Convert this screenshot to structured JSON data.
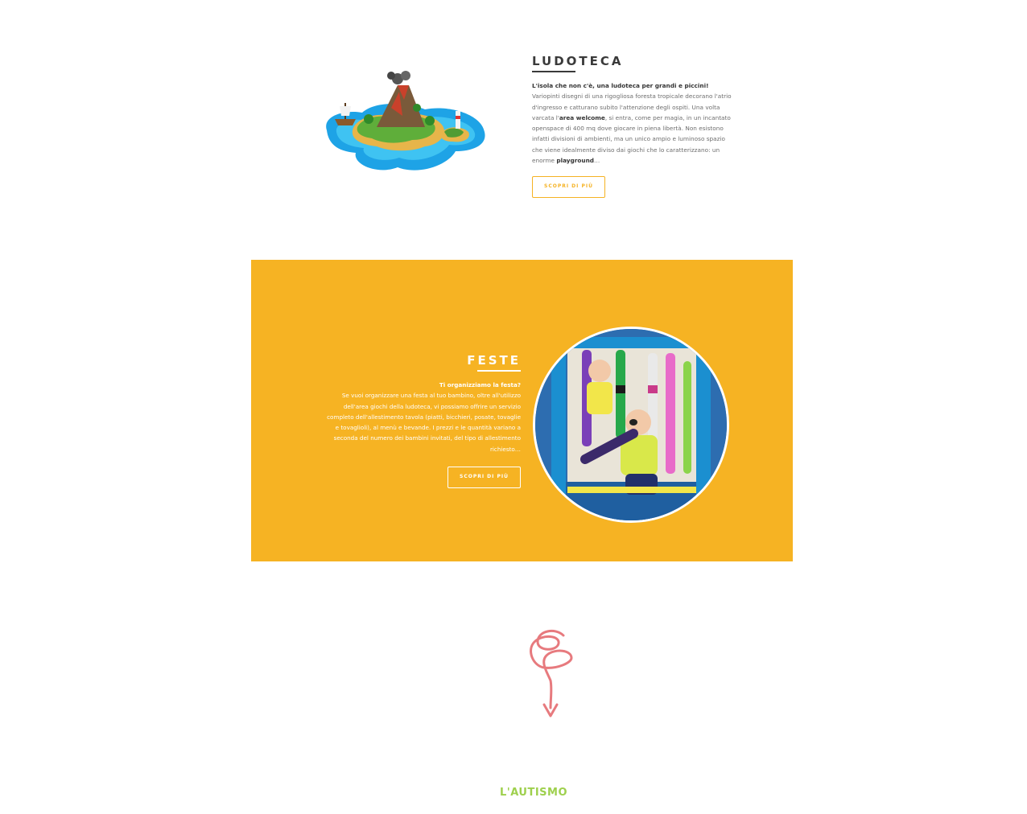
{
  "ludoteca": {
    "title": "LUDOTECA",
    "intro": "L'isola che non c'è, una ludoteca per grandi e piccini!",
    "body_1": "Variopinti disegni di una rigogliosa foresta tropicale decorano l'atrio d'ingresso e catturano subito l'attenzione degli ospiti. Una volta varcata l'",
    "body_bold_1": "area welcome",
    "body_2": ", si entra, come per magia, in un incantato openspace di 400 mq dove giocare in piena libertà. Non esistono infatti divisioni di ambienti, ma un unico ampio e luminoso spazio che viene idealmente diviso dai giochi che lo caratterizzano: un enorme ",
    "body_bold_2": "playground",
    "body_3": "…",
    "button_label": "SCOPRI DI PIÙ",
    "illustration_icon": "island-illustration"
  },
  "feste": {
    "title": "FESTE",
    "intro": "Ti organizziamo la festa?",
    "body": "Se vuoi organizzare una festa al tuo bambino, oltre all'utilizzo dell'area giochi della ludoteca, vi possiamo offrire un servizio completo dell'allestimento tavola (piatti, bicchieri, posate, tovaglie e tovaglioli), al menù e bevande. I prezzi e le quantità variano a seconda del numero dei bambini invitati, del tipo di allestimento richiesto…",
    "button_label": "SCOPRI DI PIÙ",
    "photo_icon": "kids-playground-photo"
  },
  "divider": {
    "icon": "squiggle-arrow-icon"
  },
  "next_section": {
    "title": "L'AUTISMO"
  },
  "colors": {
    "accent_yellow": "#f6b323",
    "squiggle_pink": "#e77a7e",
    "autismo_green": "#9ed04d",
    "title_dark": "#3a3a3a"
  }
}
